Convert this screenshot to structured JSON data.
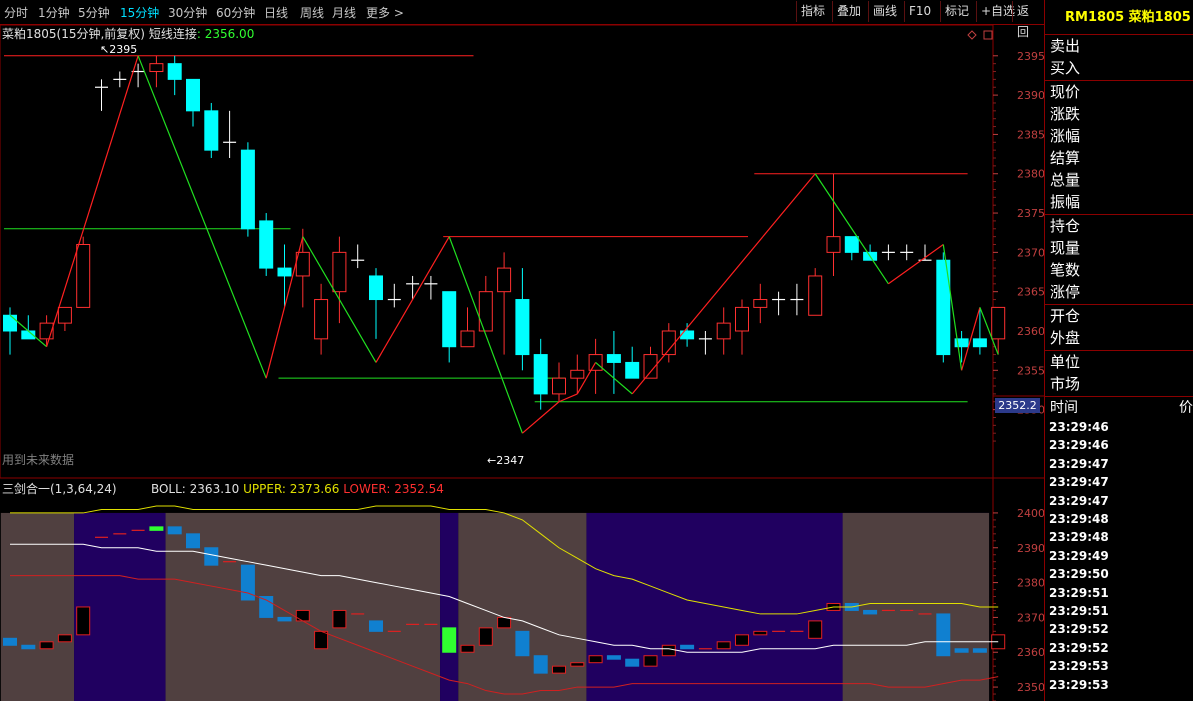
{
  "toolbar": {
    "timeframes": [
      "分时",
      "1分钟",
      "5分钟",
      "15分钟",
      "30分钟",
      "60分钟",
      "日线",
      "周线",
      "月线",
      "更多 >"
    ],
    "active_timeframe": "15分钟",
    "buttons": [
      "指标",
      "叠加",
      "画线",
      "F10",
      "标记",
      "+自选",
      "返回"
    ]
  },
  "header": {
    "symbol_desc": "菜粕1805(15分钟,前复权)",
    "line_name": "短线连接",
    "line_value": ": 2356.00"
  },
  "indicator": {
    "name": "三剑合一(1,3,64,24)",
    "boll": "BOLL: 2363.10",
    "upper": "UPPER: 2373.66",
    "lower": "LOWER: 2352.54"
  },
  "notes": {
    "future_data": "用到未来数据",
    "high_label": "2395",
    "low_label": "2347"
  },
  "current_price": "2352.2",
  "right_panel": {
    "title": "RM1805 菜粕1805",
    "groups": [
      [
        "卖出",
        "买入"
      ],
      [
        "现价",
        "涨跌",
        "涨幅",
        "结算",
        "总量",
        "振幅"
      ],
      [
        "持仓",
        "现量",
        "笔数",
        "涨停"
      ],
      [
        "开仓",
        "外盘"
      ],
      [
        "单位",
        "市场"
      ]
    ],
    "time_header": "时间",
    "price_header": "价",
    "times": [
      "23:29:46",
      "23:29:46",
      "23:29:47",
      "23:29:47",
      "23:29:47",
      "23:29:48",
      "23:29:48",
      "23:29:49",
      "23:29:50",
      "23:29:51",
      "23:29:51",
      "23:29:52",
      "23:29:52",
      "23:29:53",
      "23:29:53"
    ]
  },
  "colors": {
    "up": "#ff3030",
    "down": "#00ffff",
    "zigzag_up": "#ff2020",
    "zigzag_down": "#20e020",
    "upper": "#e0e000",
    "mid": "#ffffff",
    "lower": "#d02020",
    "band_gray": "#504040",
    "band_purple": "#200060"
  },
  "chart_data": [
    {
      "type": "candlestick",
      "yticks": [
        2395,
        2390,
        2385,
        2380,
        2375,
        2370,
        2365,
        2360,
        2355,
        2350
      ],
      "ylim": [
        2345.5,
        2396.5
      ],
      "candles": [
        [
          2362,
          2360,
          2363,
          2357
        ],
        [
          2360,
          2359,
          2362,
          2359
        ],
        [
          2359,
          2361,
          2362,
          2358
        ],
        [
          2361,
          2363,
          2363,
          2360
        ],
        [
          2363,
          2371,
          2372,
          2363
        ],
        [
          2391,
          2391,
          2392,
          2388
        ],
        [
          2392,
          2392,
          2393,
          2391
        ],
        [
          2393,
          2393,
          2394,
          2391
        ],
        [
          2393,
          2394,
          2395,
          2391
        ],
        [
          2394,
          2392,
          2395,
          2390
        ],
        [
          2392,
          2388,
          2392,
          2386
        ],
        [
          2388,
          2383,
          2389,
          2382
        ],
        [
          2384,
          2384,
          2388,
          2382
        ],
        [
          2383,
          2373,
          2384,
          2372
        ],
        [
          2374,
          2368,
          2375,
          2367
        ],
        [
          2368,
          2367,
          2371,
          2363
        ],
        [
          2367,
          2370,
          2373,
          2363
        ],
        [
          2359,
          2364,
          2366,
          2357
        ],
        [
          2365,
          2370,
          2372,
          2361
        ],
        [
          2369,
          2369,
          2371,
          2368
        ],
        [
          2367,
          2364,
          2368,
          2359
        ],
        [
          2364,
          2364,
          2366,
          2363
        ],
        [
          2366,
          2366,
          2367,
          2364
        ],
        [
          2366,
          2366,
          2367,
          2364
        ],
        [
          2365,
          2358,
          2365,
          2356
        ],
        [
          2358,
          2360,
          2363,
          2358
        ],
        [
          2360,
          2365,
          2367,
          2360
        ],
        [
          2365,
          2368,
          2370,
          2357
        ],
        [
          2364,
          2357,
          2368,
          2355
        ],
        [
          2357,
          2352,
          2359,
          2350
        ],
        [
          2352,
          2354,
          2356,
          2351
        ],
        [
          2354,
          2355,
          2357,
          2352
        ],
        [
          2355,
          2357,
          2359,
          2352
        ],
        [
          2357,
          2356,
          2360,
          2352
        ],
        [
          2356,
          2354,
          2358,
          2355
        ],
        [
          2354,
          2357,
          2358,
          2354
        ],
        [
          2357,
          2360,
          2361,
          2356
        ],
        [
          2360,
          2359,
          2361,
          2358
        ],
        [
          2359,
          2359,
          2360,
          2357
        ],
        [
          2359,
          2361,
          2363,
          2357
        ],
        [
          2360,
          2363,
          2364,
          2357
        ],
        [
          2363,
          2364,
          2366,
          2361
        ],
        [
          2364,
          2364,
          2365,
          2362
        ],
        [
          2364,
          2364,
          2366,
          2362
        ],
        [
          2362,
          2367,
          2368,
          2362
        ],
        [
          2370,
          2372,
          2380,
          2367
        ],
        [
          2372,
          2370,
          2372,
          2369
        ],
        [
          2370,
          2369,
          2371,
          2369
        ],
        [
          2370,
          2370,
          2371,
          2369
        ],
        [
          2370,
          2370,
          2371,
          2369
        ],
        [
          2369,
          2369,
          2371,
          2369
        ],
        [
          2369,
          2357,
          2370,
          2356
        ],
        [
          2359,
          2358,
          2360,
          2356
        ],
        [
          2359,
          2358,
          2363,
          2357
        ],
        [
          2359,
          2363,
          2363,
          2357
        ]
      ],
      "zigzag": [
        [
          0,
          2362,
          "g"
        ],
        [
          2,
          2358,
          "r"
        ],
        [
          7,
          2395,
          "g"
        ],
        [
          14,
          2354,
          "r"
        ],
        [
          16,
          2372,
          "g"
        ],
        [
          20,
          2356,
          "r"
        ],
        [
          24,
          2372,
          "g"
        ],
        [
          28,
          2347,
          "r"
        ],
        [
          30,
          2351,
          "g"
        ],
        [
          31,
          2352,
          "r"
        ],
        [
          32,
          2356,
          "g"
        ],
        [
          34,
          2352,
          "r"
        ],
        [
          44,
          2380,
          "g"
        ],
        [
          48,
          2366,
          "r"
        ],
        [
          51,
          2371,
          "g"
        ],
        [
          52,
          2355,
          "r"
        ],
        [
          53,
          2363,
          "g"
        ],
        [
          54,
          2357,
          "r"
        ]
      ],
      "hlines": [
        [
          0,
          2395,
          25,
          "r"
        ],
        [
          0,
          2373,
          15,
          "g"
        ],
        [
          15,
          2354,
          30,
          "g"
        ],
        [
          24,
          2372,
          40,
          "r"
        ],
        [
          29,
          2351,
          52,
          "g"
        ],
        [
          41,
          2380,
          52,
          "r"
        ]
      ]
    },
    {
      "type": "boll",
      "yticks": [
        2400,
        2390,
        2380,
        2370,
        2360,
        2350
      ],
      "ylim": [
        2346,
        2404
      ],
      "upper": [
        2400,
        2400,
        2400,
        2400,
        2400,
        2401,
        2401,
        2401,
        2402,
        2402,
        2401,
        2401,
        2401,
        2401,
        2401,
        2401,
        2401,
        2401,
        2401,
        2401,
        2402,
        2402,
        2402,
        2402,
        2401,
        2401,
        2401,
        2400,
        2398,
        2394,
        2390,
        2387,
        2384,
        2382,
        2381,
        2379,
        2377,
        2375,
        2374,
        2373,
        2372,
        2371,
        2371,
        2371,
        2372,
        2373,
        2373,
        2374,
        2374,
        2374,
        2374,
        2374,
        2374,
        2373,
        2373
      ],
      "mid": [
        2391,
        2391,
        2391,
        2391,
        2391,
        2390,
        2390,
        2390,
        2389,
        2389,
        2389,
        2388,
        2387,
        2386,
        2385,
        2384,
        2383,
        2382,
        2382,
        2381,
        2380,
        2379,
        2378,
        2377,
        2376,
        2374,
        2372,
        2370,
        2369,
        2367,
        2365,
        2364,
        2363,
        2362,
        2362,
        2361,
        2361,
        2360,
        2360,
        2360,
        2360,
        2361,
        2361,
        2361,
        2361,
        2362,
        2362,
        2362,
        2362,
        2362,
        2363,
        2363,
        2363,
        2363,
        2363
      ],
      "lower": [
        2382,
        2382,
        2382,
        2382,
        2382,
        2382,
        2382,
        2381,
        2381,
        2381,
        2380,
        2379,
        2378,
        2377,
        2375,
        2372,
        2369,
        2366,
        2364,
        2362,
        2360,
        2358,
        2356,
        2354,
        2352,
        2351,
        2349,
        2348,
        2348,
        2349,
        2349,
        2350,
        2350,
        2350,
        2351,
        2351,
        2351,
        2351,
        2351,
        2351,
        2351,
        2351,
        2351,
        2351,
        2351,
        2351,
        2351,
        2351,
        2350,
        2350,
        2350,
        2351,
        2352,
        2352,
        2353
      ],
      "bands": [
        [
          0,
          4,
          "gray"
        ],
        [
          4,
          9,
          "purple"
        ],
        [
          9,
          24,
          "gray"
        ],
        [
          24,
          25,
          "purple"
        ],
        [
          25,
          32,
          "gray"
        ],
        [
          32,
          46,
          "purple"
        ],
        [
          46,
          54,
          "purple"
        ],
        [
          46,
          54,
          "gray"
        ]
      ]
    }
  ]
}
